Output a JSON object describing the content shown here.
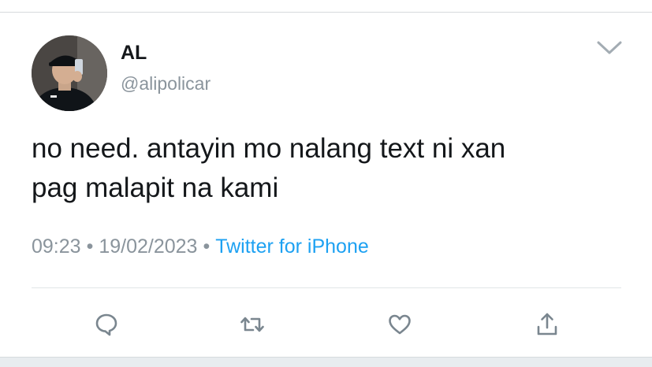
{
  "tweet": {
    "display_name": "AL",
    "handle": "@alipolicar",
    "text": "no need. antayin mo nalang text ni xan\npag malapit na kami",
    "time": "09:23",
    "date": "19/02/2023",
    "separator": "•",
    "source": "Twitter for iPhone"
  },
  "icons": {
    "menu": "chevron-down-icon",
    "reply": "reply-icon",
    "retweet": "retweet-icon",
    "like": "heart-icon",
    "share": "share-icon"
  },
  "colors": {
    "text": "#14171a",
    "secondary": "#8a949c",
    "link": "#1da1f2",
    "icon": "#7a868f",
    "divider": "#e1e5e8"
  }
}
